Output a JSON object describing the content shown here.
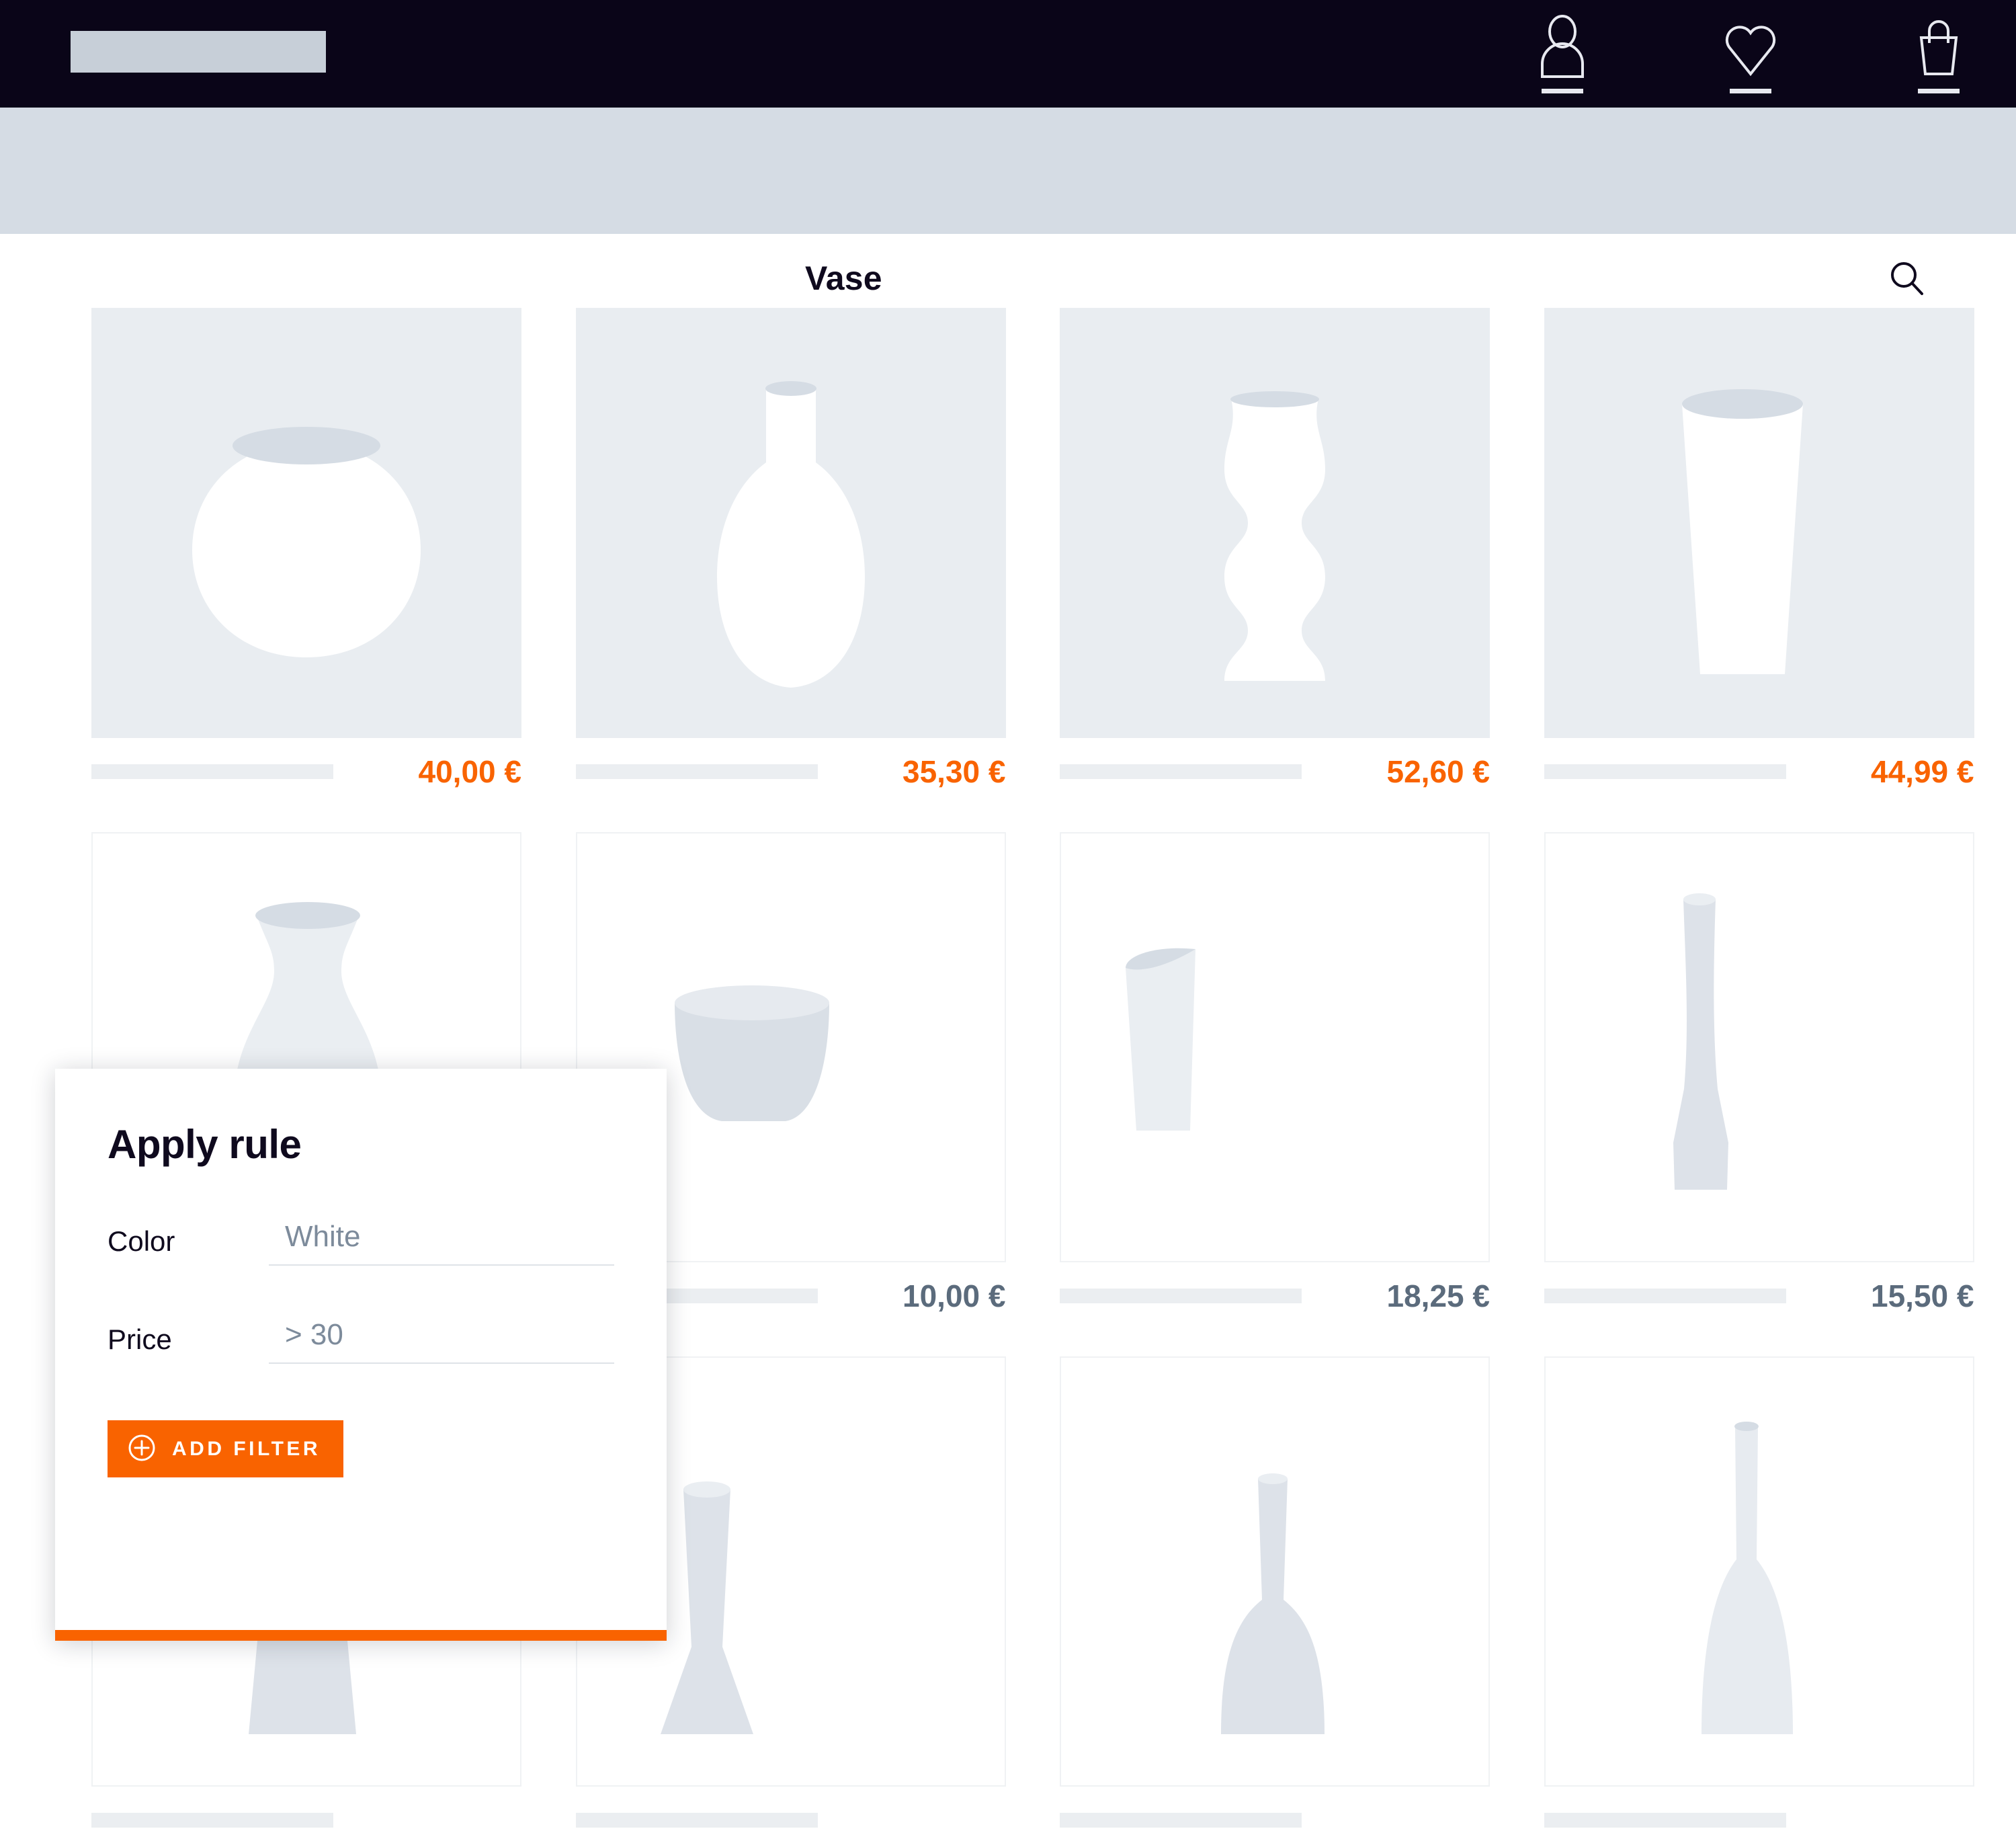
{
  "header": {
    "logo": "logo-placeholder",
    "icons": [
      {
        "name": "user-account-icon",
        "label": "Account"
      },
      {
        "name": "heart-wishlist-icon",
        "label": "Wishlist"
      },
      {
        "name": "shopping-bag-icon",
        "label": "Cart"
      }
    ]
  },
  "search": {
    "value": "Vase",
    "placeholder": "Vase",
    "icon": "search-icon"
  },
  "grid": {
    "rows": [
      {
        "style": "filled",
        "products": [
          {
            "shape": "round-bowl-vase",
            "price": "40,00 €",
            "price_style": "accent",
            "title": ""
          },
          {
            "shape": "bottle-neck-vase",
            "price": "35,30 €",
            "price_style": "accent",
            "title": ""
          },
          {
            "shape": "wavy-lobed-vase",
            "price": "52,60 €",
            "price_style": "accent",
            "title": ""
          },
          {
            "shape": "tapered-cylinder-vase",
            "price": "44,99 €",
            "price_style": "accent",
            "title": ""
          }
        ]
      },
      {
        "style": "outlined",
        "products": [
          {
            "shape": "flared-neck-vase",
            "price": "",
            "price_style": "muted",
            "title": ""
          },
          {
            "shape": "wide-bowl-vase",
            "price": "10,00 €",
            "price_style": "muted",
            "title": ""
          },
          {
            "shape": "slanted-cup-vase",
            "price": "18,25 €",
            "price_style": "muted",
            "title": ""
          },
          {
            "shape": "slim-tall-vase",
            "price": "15,50 €",
            "price_style": "muted",
            "title": ""
          }
        ]
      },
      {
        "style": "outlined",
        "products": [
          {
            "shape": "conical-vase",
            "price": "",
            "price_style": "muted",
            "title": ""
          },
          {
            "shape": "tapered-tall-vase",
            "price": "",
            "price_style": "muted",
            "title": ""
          },
          {
            "shape": "bulb-neck-vase",
            "price": "",
            "price_style": "muted",
            "title": ""
          },
          {
            "shape": "narrow-stem-vase",
            "price": "",
            "price_style": "muted",
            "title": ""
          }
        ]
      }
    ]
  },
  "modal": {
    "title": "Apply rule",
    "fields": [
      {
        "label": "Color",
        "value": "White"
      },
      {
        "label": "Price",
        "value": "> 30"
      }
    ],
    "add_filter_label": "ADD FILTER",
    "add_filter_icon": "plus-circle-icon"
  },
  "colors": {
    "accent": "#f96300",
    "nav_background": "#0a0518",
    "search_background": "#d5dce4",
    "tile_background": "#e9edf1",
    "muted_text": "#5b6b7c"
  }
}
